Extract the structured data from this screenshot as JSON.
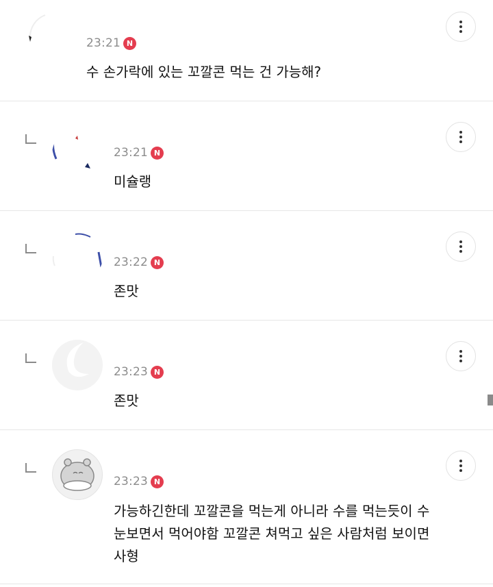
{
  "badge_label": "N",
  "colors": {
    "badge": "#e43d4f",
    "divider": "#e6e6e6",
    "time": "#8c8c8c"
  },
  "comments": [
    {
      "time": "23:21",
      "text": "수 손가락에 있는 꼬깔콘 먹는 건 가능해?",
      "is_reply": false
    },
    {
      "time": "23:21",
      "text": "미슐랭",
      "is_reply": true
    },
    {
      "time": "23:22",
      "text": "존맛",
      "is_reply": true
    },
    {
      "time": "23:23",
      "text": "존맛",
      "is_reply": true
    },
    {
      "time": "23:23",
      "text": "가능하긴한데 꼬깔콘을 먹는게 아니라 수를 먹는듯이 수\n눈보면서 먹어야함 꼬깔콘 쳐먹고 싶은 사람처럼 보이면\n사형",
      "is_reply": true
    }
  ],
  "icons": {
    "more": "more-vertical-icon",
    "reply": "reply-arrow-icon",
    "badge": "new-badge-icon"
  }
}
